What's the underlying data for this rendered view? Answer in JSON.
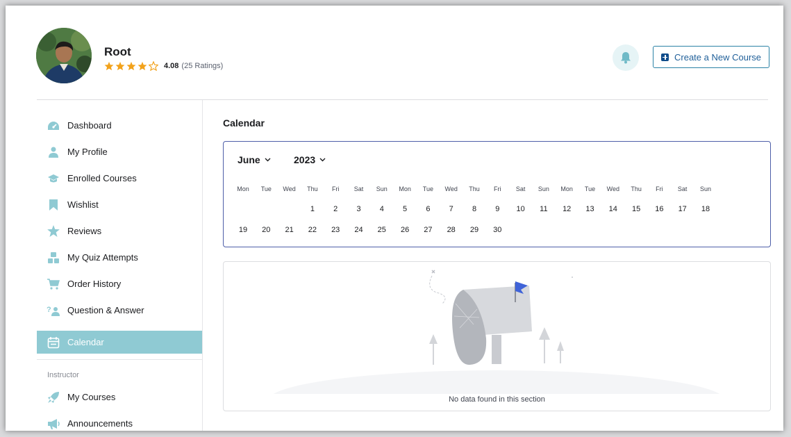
{
  "user": {
    "name": "Root",
    "rating_value": "4.08",
    "rating_count": "(25 Ratings)",
    "stars": 4
  },
  "header": {
    "create_course_label": "Create a New Course"
  },
  "sidebar": {
    "items": [
      {
        "label": "Dashboard",
        "icon": "dashboard-icon"
      },
      {
        "label": "My Profile",
        "icon": "user-icon"
      },
      {
        "label": "Enrolled Courses",
        "icon": "graduation-cap-icon"
      },
      {
        "label": "Wishlist",
        "icon": "bookmark-icon"
      },
      {
        "label": "Reviews",
        "icon": "star-icon"
      },
      {
        "label": "My Quiz Attempts",
        "icon": "quiz-icon"
      },
      {
        "label": "Order History",
        "icon": "cart-icon"
      },
      {
        "label": "Question & Answer",
        "icon": "question-answer-icon"
      },
      {
        "label": "Calendar",
        "icon": "calendar-icon",
        "active": true
      }
    ],
    "instructor_label": "Instructor",
    "instructor_items": [
      {
        "label": "My Courses",
        "icon": "rocket-icon"
      },
      {
        "label": "Announcements",
        "icon": "megaphone-icon"
      }
    ]
  },
  "main": {
    "title": "Calendar",
    "month": "June",
    "year": "2023",
    "weekdays": [
      "Mon",
      "Tue",
      "Wed",
      "Thu",
      "Fri",
      "Sat",
      "Sun",
      "Mon",
      "Tue",
      "Wed",
      "Thu",
      "Fri",
      "Sat",
      "Sun",
      "Mon",
      "Tue",
      "Wed",
      "Thu",
      "Fri",
      "Sat",
      "Sun"
    ],
    "days_row1": [
      "1",
      "2",
      "3",
      "4",
      "5",
      "6",
      "7",
      "8",
      "9",
      "10",
      "11",
      "12",
      "13",
      "14",
      "15",
      "16",
      "17",
      "18"
    ],
    "days_row2": [
      "19",
      "20",
      "21",
      "22",
      "23",
      "24",
      "25",
      "26",
      "27",
      "28",
      "29",
      "30"
    ],
    "empty_message": "No data found in this section"
  },
  "colors": {
    "accent": "#8fcad3",
    "star": "#f2a21b",
    "calendar_border": "#4d5ea8",
    "button_text": "#1f5f99"
  }
}
